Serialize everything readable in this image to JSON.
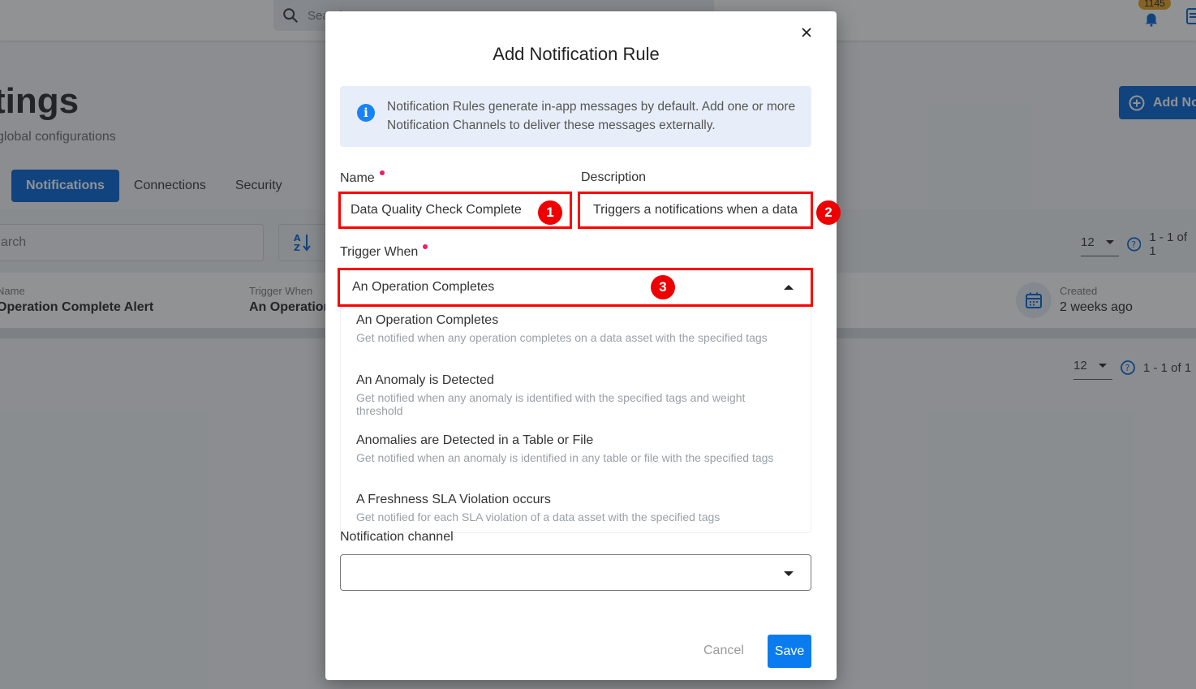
{
  "topbar": {
    "search_placeholder": "Search",
    "notifications_count": "1145"
  },
  "page": {
    "title": "Settings",
    "title_visible": "tings",
    "subtitle_visible": "global configurations",
    "add_button_label": "Add No",
    "tabs": [
      {
        "label": "Notifications",
        "active": true
      },
      {
        "label": "Connections",
        "active": false
      },
      {
        "label": "Security",
        "active": false
      }
    ],
    "search_placeholder_visible": "arch",
    "pagination": {
      "page_size": "12",
      "range": "1 - 1 of 1"
    },
    "rule_card": {
      "name_label": "Name",
      "name_value": "Operation Complete Alert",
      "trigger_label": "Trigger When",
      "trigger_value": "An Operation",
      "created_label": "Created",
      "created_value": "2 weeks ago"
    }
  },
  "modal": {
    "title": "Add Notification Rule",
    "info_text": "Notification Rules generate in-app messages by default. Add one or more Notification Channels to deliver these messages externally.",
    "name_label": "Name",
    "name_value": "Data Quality Check Complete",
    "description_label": "Description",
    "description_value": "Triggers a notifications when a data",
    "trigger_label": "Trigger When",
    "trigger_value": "An Operation Completes",
    "trigger_options": [
      {
        "title": "An Operation Completes",
        "description": "Get notified when any operation completes on a data asset with the specified tags"
      },
      {
        "title": "An Anomaly is Detected",
        "description": "Get notified when any anomaly is identified with the specified tags and weight threshold"
      },
      {
        "title": "Anomalies are Detected in a Table or File",
        "description": "Get notified when an anomaly is identified in any table or file with the specified tags"
      },
      {
        "title": "A Freshness SLA Violation occurs",
        "description": "Get notified for each SLA violation of a data asset with the specified tags"
      }
    ],
    "channel_label": "Notification channel",
    "channel_value": "",
    "cancel_label": "Cancel",
    "save_label": "Save"
  },
  "annotations": [
    "1",
    "2",
    "3"
  ],
  "colors": {
    "primary": "#0061d2",
    "save": "#0a7cf0",
    "annotation_red": "#ff0000",
    "required_dot": "#e91e63",
    "info_bg": "#e8eef9",
    "badge": "#e8a11a"
  }
}
